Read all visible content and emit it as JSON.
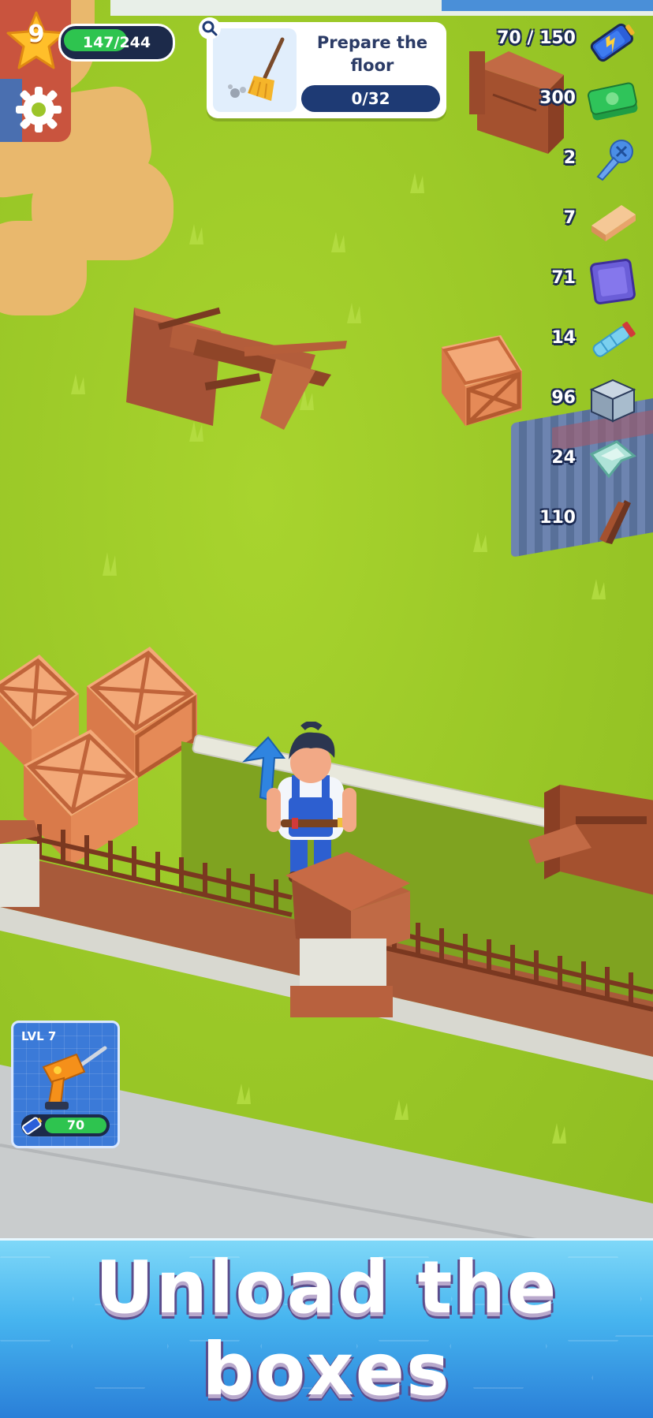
{
  "player": {
    "level": "9",
    "xp_text": "147/244",
    "xp_fraction": 0.6
  },
  "quest": {
    "title": "Prepare the floor",
    "progress_text": "0/32",
    "progress_fraction": 0,
    "icon": "broom-icon"
  },
  "resources": [
    {
      "name": "energy",
      "value": "70 / 150",
      "icon": "battery-icon",
      "color": "#2b5fd9"
    },
    {
      "name": "cash",
      "value": "300",
      "icon": "cash-icon",
      "color": "#2fc45a"
    },
    {
      "name": "screws",
      "value": "2",
      "icon": "screw-icon",
      "color": "#4b8ee6"
    },
    {
      "name": "bricks",
      "value": "7",
      "icon": "brick-icon",
      "color": "#f0b676"
    },
    {
      "name": "tiles",
      "value": "71",
      "icon": "tile-icon",
      "color": "#6b5ed8"
    },
    {
      "name": "pipes",
      "value": "14",
      "icon": "pipe-icon",
      "color": "#7ad0ef"
    },
    {
      "name": "blocks",
      "value": "96",
      "icon": "block-icon",
      "color": "#a8bccd"
    },
    {
      "name": "glass",
      "value": "24",
      "icon": "glass-icon",
      "color": "#aee3d8"
    },
    {
      "name": "planks",
      "value": "110",
      "icon": "plank-icon",
      "color": "#8c4a2e"
    }
  ],
  "tool": {
    "level_label": "LVL 7",
    "energy": "70",
    "icon": "drill-icon"
  },
  "banner": {
    "text": "Unload the\nboxes"
  }
}
